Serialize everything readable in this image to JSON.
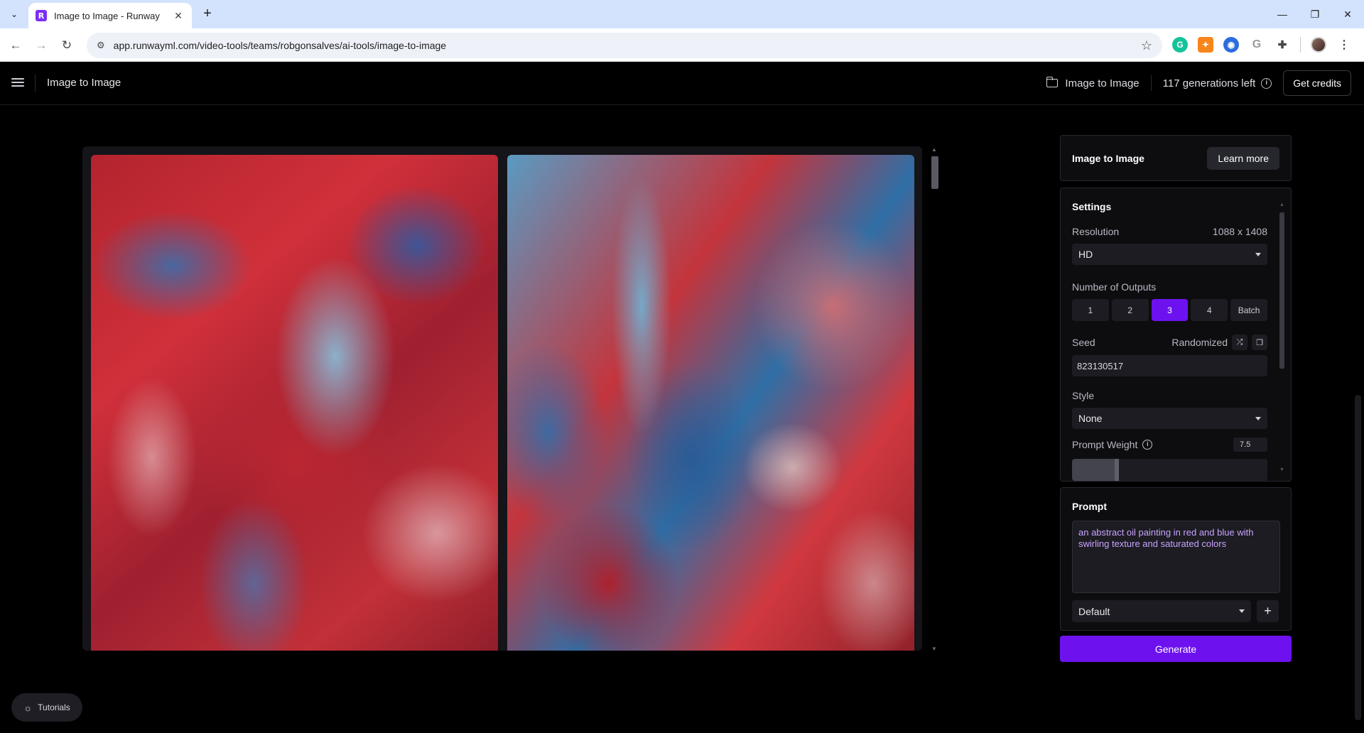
{
  "browser": {
    "tab_title": "Image to Image - Runway",
    "favicon_letter": "R",
    "tab_close": "✕",
    "new_tab": "+",
    "url": "app.runwayml.com/video-tools/teams/robgonsalves/ai-tools/image-to-image",
    "window_controls": [
      "—",
      "❐",
      "✕"
    ]
  },
  "header": {
    "title": "Image to Image",
    "project": "Image to Image",
    "generations_left": "117 generations left",
    "info_glyph": "i",
    "get_credits": "Get credits"
  },
  "panel": {
    "title": "Image to Image",
    "learn_more": "Learn more"
  },
  "settings": {
    "title": "Settings",
    "resolution_label": "Resolution",
    "resolution_value": "1088 x 1408",
    "resolution_select": "HD",
    "outputs_label": "Number of Outputs",
    "outputs_options": [
      "1",
      "2",
      "3",
      "4",
      "Batch"
    ],
    "outputs_selected": "3",
    "seed_label": "Seed",
    "seed_mode": "Randomized",
    "seed_value": "823130517",
    "style_label": "Style",
    "style_select": "None",
    "prompt_weight_label": "Prompt Weight",
    "prompt_weight_value": "7.5",
    "prompt_weight_fraction": 0.23
  },
  "prompt": {
    "title": "Prompt",
    "text": "an abstract oil painting in red and blue with swirling texture and saturated colors",
    "preset": "Default",
    "add": "+"
  },
  "generate_label": "Generate",
  "tutorials_label": "Tutorials",
  "colors": {
    "accent": "#6d12ef",
    "prompt_text": "#c9a3ff",
    "background": "#000000"
  }
}
